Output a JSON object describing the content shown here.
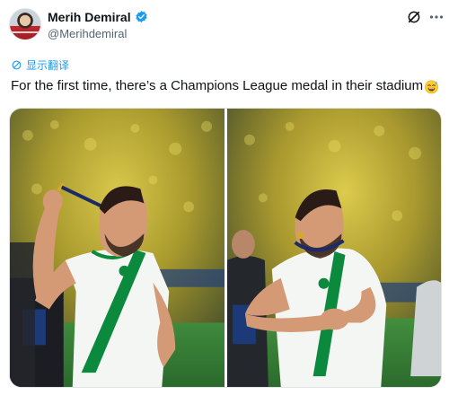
{
  "author": {
    "display_name": "Merih Demiral",
    "handle": "@Merihdemiral",
    "verified": true
  },
  "translate": {
    "label": "显示翻译"
  },
  "tweet": {
    "text": "For the first time, there’s a Champions League medal in their stadium",
    "emoji": "sweat-smile-emoji"
  },
  "media": {
    "count": 2
  },
  "colors": {
    "accent": "#1d9bf0",
    "text": "#0f1419",
    "secondary": "#536471",
    "jersey_green": "#0b8a3e",
    "stadium_yellow": "#d8c23a"
  }
}
